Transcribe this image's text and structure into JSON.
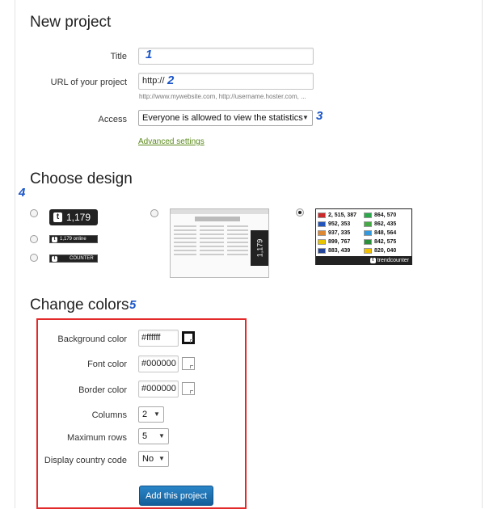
{
  "sections": {
    "new_project": "New project",
    "choose_design": "Choose design",
    "change_colors": "Change colors"
  },
  "markers": {
    "m1": "1",
    "m2": "2",
    "m3": "3",
    "m4": "4",
    "m5": "5"
  },
  "form": {
    "title_label": "Title",
    "title_value": "",
    "url_label": "URL of your project",
    "url_value": "http://",
    "url_hint": "http://www.mywebsite.com, http://username.hoster.com, ...",
    "access_label": "Access",
    "access_value": "Everyone is allowed to view the statistics",
    "advanced_link": "Advanced settings"
  },
  "designs": {
    "badge_big_count": "1,179",
    "badge_online": "1,179 online",
    "badge_counter": "COUNTER",
    "vertical_count": "1,179",
    "t_logo": "t",
    "flag_rows": [
      [
        "2, 515, 387",
        "864, 570"
      ],
      [
        "952, 353",
        "862, 435"
      ],
      [
        "937, 335",
        "848, 564"
      ],
      [
        "899, 767",
        "842, 575"
      ],
      [
        "883, 439",
        "820, 040"
      ]
    ],
    "flag_colors": [
      [
        "#cc2a2a",
        "#2aa84a"
      ],
      [
        "#2255bb",
        "#44aa44"
      ],
      [
        "#dd8833",
        "#3399dd"
      ],
      [
        "#e6c400",
        "#2a8f3a"
      ],
      [
        "#224499",
        "#f0c000"
      ]
    ],
    "flag_footer": "trendcounter"
  },
  "colors": {
    "background_label": "Background color",
    "background_value": "#ffffff",
    "font_label": "Font color",
    "font_value": "#000000",
    "border_label": "Border color",
    "border_value": "#000000",
    "columns_label": "Columns",
    "columns_value": "2",
    "rows_label": "Maximum rows",
    "rows_value": "5",
    "country_label": "Display country code",
    "country_value": "No",
    "submit": "Add this project",
    "highlight": "#e32a2a",
    "button": "#1a6fae",
    "link": "#5a8a19",
    "marker": "#1a55c8"
  }
}
